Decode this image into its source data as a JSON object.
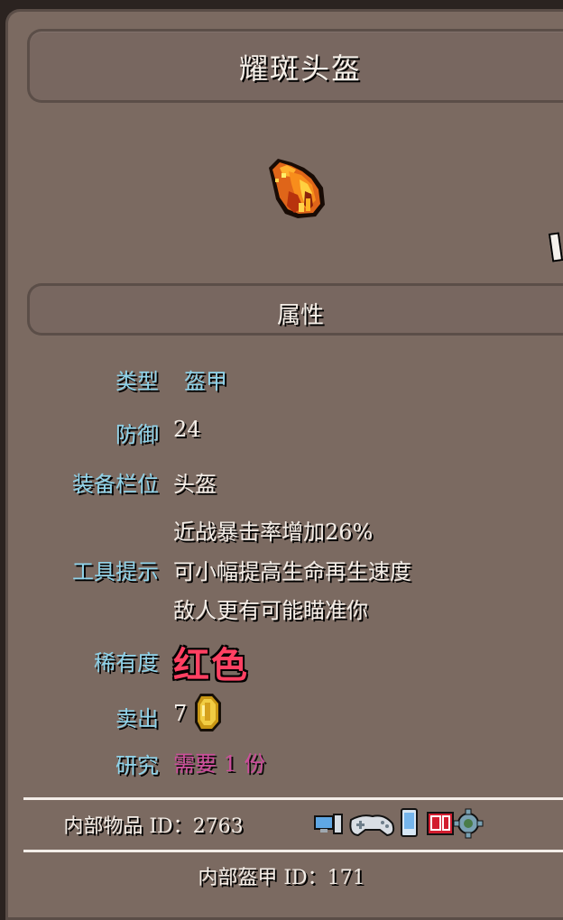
{
  "item": {
    "name": "耀斑头盔",
    "icon": "flare-helmet-icon"
  },
  "section": {
    "title": "属性"
  },
  "stats": {
    "type_label": "类型",
    "type_value": "盔甲",
    "defense_label": "防御",
    "defense_value": "24",
    "slot_label": "装备栏位",
    "slot_value": "头盔",
    "tooltip_label": "工具提示",
    "tooltip_lines": [
      "近战暴击率增加26%",
      "可小幅提高生命再生速度",
      "敌人更有可能瞄准你"
    ],
    "rarity_label": "稀有度",
    "rarity_value": "红色",
    "sell_label": "卖出",
    "sell_value": "7",
    "sell_icon": "gold-coin-icon",
    "research_label": "研究",
    "research_value": "需要 1 份"
  },
  "ids": {
    "internal_item_label": "内部物品 ID：",
    "internal_item_value": "2763",
    "platform_icons": [
      "pc-icon",
      "controller-icon",
      "mobile-icon",
      "switch-icon",
      "gear-icon"
    ],
    "internal_armor_label": "内部盔甲 ID：",
    "internal_armor_value": "171"
  },
  "colors": {
    "panel": "#7b6a61",
    "label_blue": "#8fd3ea",
    "rarity_red": "#ff4062",
    "research_pink": "#d64aa3"
  }
}
